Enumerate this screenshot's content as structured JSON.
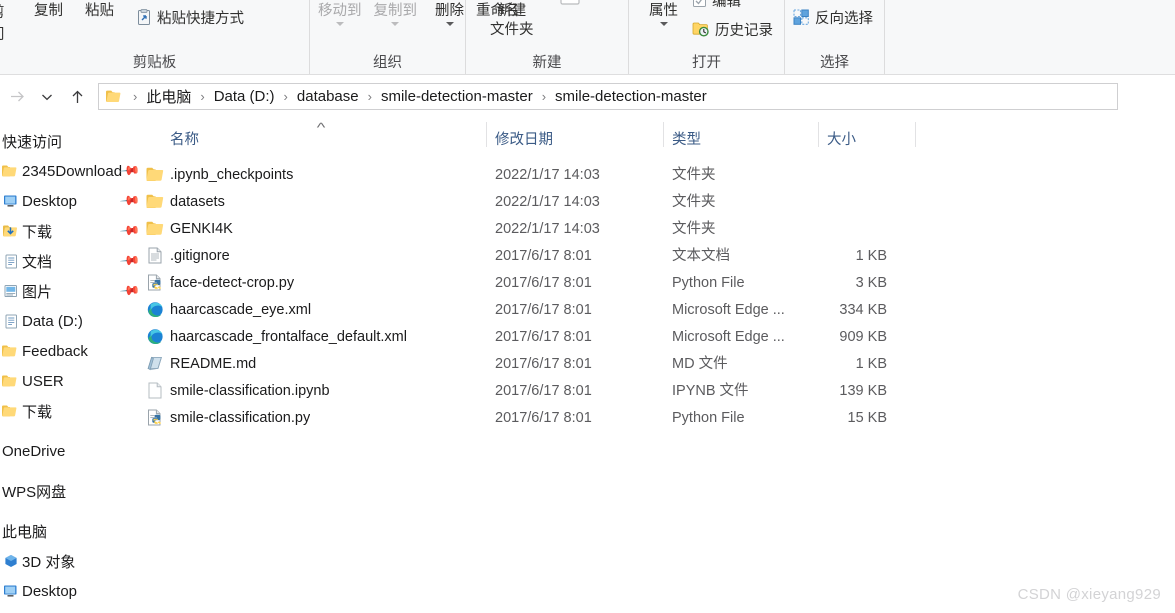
{
  "ribbon": {
    "groups": [
      {
        "name": "clipboard",
        "title": "剪贴板",
        "clipped_left_top": "剪",
        "clipped_left_bottom": "问",
        "buttons": [
          {
            "label": "复制",
            "kind": "big"
          },
          {
            "label": "粘贴",
            "kind": "big"
          }
        ],
        "small_buttons": [
          {
            "label": "粘贴快捷方式",
            "icon": "paste-shortcut-icon"
          }
        ]
      },
      {
        "name": "organize",
        "title": "组织",
        "buttons": [
          {
            "label": "移动到",
            "kind": "big",
            "caret": true,
            "disabled": true
          },
          {
            "label": "复制到",
            "kind": "big",
            "caret": true,
            "disabled": true
          },
          {
            "label": "删除",
            "kind": "big",
            "caret": true,
            "disabled": false
          },
          {
            "label": "重命名",
            "kind": "big",
            "caret": false,
            "disabled": false
          }
        ]
      },
      {
        "name": "new",
        "title": "新建",
        "buttons": [
          {
            "label": "新建",
            "label2": "文件夹",
            "kind": "big"
          }
        ]
      },
      {
        "name": "open",
        "title": "打开",
        "buttons": [
          {
            "label": "属性",
            "kind": "big",
            "caret": true
          }
        ],
        "small_buttons": [
          {
            "label": "编辑",
            "icon": "edit-checkbox-icon",
            "clipped": true
          },
          {
            "label": "历史记录",
            "icon": "history-icon"
          }
        ]
      },
      {
        "name": "select",
        "title": "选择",
        "small_buttons": [
          {
            "label": "反向选择",
            "icon": "invert-selection-icon"
          }
        ]
      }
    ]
  },
  "address": {
    "back_icon": "back-arrow-icon",
    "forward_icon": "forward-arrow-icon",
    "recent_icon": "chevron-down-icon",
    "up_icon": "up-arrow-icon",
    "folder_icon": "folder-icon",
    "crumbs": [
      "此电脑",
      "Data (D:)",
      "database",
      "smile-detection-master",
      "smile-detection-master"
    ],
    "separator": "›"
  },
  "sidebar": {
    "sections": [
      {
        "header": "快速访问",
        "items": [
          {
            "label": "2345Download",
            "icon": "folder-icon",
            "pinned": true
          },
          {
            "label": "Desktop",
            "icon": "desktop-icon",
            "pinned": true
          },
          {
            "label": "下载",
            "icon": "downloads-icon",
            "pinned": true
          },
          {
            "label": "文档",
            "icon": "documents-icon",
            "pinned": true
          },
          {
            "label": "图片",
            "icon": "pictures-icon",
            "pinned": true
          },
          {
            "label": "Data (D:)",
            "icon": "documents-icon",
            "pinned": false
          },
          {
            "label": "Feedback",
            "icon": "folder-icon",
            "pinned": false
          },
          {
            "label": "USER",
            "icon": "folder-icon",
            "pinned": false
          },
          {
            "label": "下载",
            "icon": "folder-icon",
            "pinned": false
          }
        ]
      },
      {
        "header": "OneDrive",
        "items": []
      },
      {
        "header": "WPS网盘",
        "items": []
      },
      {
        "header": "此电脑",
        "items": [
          {
            "label": "3D 对象",
            "icon": "3d-objects-icon",
            "pinned": false
          },
          {
            "label": "Desktop",
            "icon": "desktop-icon",
            "pinned": false
          }
        ]
      }
    ]
  },
  "columns": {
    "headers": [
      {
        "label": "名称",
        "key": "name",
        "sorted": "asc"
      },
      {
        "label": "修改日期",
        "key": "date"
      },
      {
        "label": "类型",
        "key": "type"
      },
      {
        "label": "大小",
        "key": "size"
      }
    ],
    "sort_caret": "^"
  },
  "files": [
    {
      "name": ".ipynb_checkpoints",
      "date": "2022/1/17 14:03",
      "type": "文件夹",
      "size": "",
      "icon": "folder-icon"
    },
    {
      "name": "datasets",
      "date": "2022/1/17 14:03",
      "type": "文件夹",
      "size": "",
      "icon": "folder-icon"
    },
    {
      "name": "GENKI4K",
      "date": "2022/1/17 14:03",
      "type": "文件夹",
      "size": "",
      "icon": "folder-icon"
    },
    {
      "name": ".gitignore",
      "date": "2017/6/17 8:01",
      "type": "文本文档",
      "size": "1 KB",
      "icon": "text-file-icon"
    },
    {
      "name": "face-detect-crop.py",
      "date": "2017/6/17 8:01",
      "type": "Python File",
      "size": "3 KB",
      "icon": "python-file-icon"
    },
    {
      "name": "haarcascade_eye.xml",
      "date": "2017/6/17 8:01",
      "type": "Microsoft Edge ...",
      "size": "334 KB",
      "icon": "edge-file-icon"
    },
    {
      "name": "haarcascade_frontalface_default.xml",
      "date": "2017/6/17 8:01",
      "type": "Microsoft Edge ...",
      "size": "909 KB",
      "icon": "edge-file-icon"
    },
    {
      "name": "README.md",
      "date": "2017/6/17 8:01",
      "type": "MD 文件",
      "size": "1 KB",
      "icon": "md-file-icon"
    },
    {
      "name": "smile-classification.ipynb",
      "date": "2017/6/17 8:01",
      "type": "IPYNB 文件",
      "size": "139 KB",
      "icon": "blank-file-icon"
    },
    {
      "name": "smile-classification.py",
      "date": "2017/6/17 8:01",
      "type": "Python File",
      "size": "15 KB",
      "icon": "python-file-icon"
    }
  ],
  "watermark": "CSDN @xieyang929",
  "colors": {
    "ribbon_bg": "#f7f8f9",
    "header_text": "#3b5b86",
    "folder": "#ffd564",
    "edge_blue": "#1f87d8",
    "python_blue": "#3572a5",
    "watermark": "#d3d3d5"
  }
}
